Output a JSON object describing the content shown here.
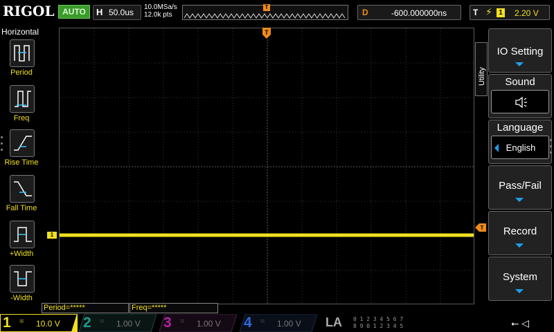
{
  "topbar": {
    "brand": "RIGOL",
    "run_state": "AUTO",
    "timebase_key": "H",
    "timebase_value": "50.0us",
    "sample_rate": "10.0MSa/s",
    "memory_depth": "12.0k pts",
    "trigger_marker": "T",
    "delay_key": "D",
    "delay_value": "-600.000000ns",
    "trigger_key": "T",
    "trigger_source": "1",
    "trigger_level": "2.20 V"
  },
  "left_panel": {
    "title": "Horizontal",
    "items": [
      {
        "label": "Period",
        "icon": "period-icon"
      },
      {
        "label": "Freq",
        "icon": "freq-icon"
      },
      {
        "label": "Rise Time",
        "icon": "rise-time-icon"
      },
      {
        "label": "Fall Time",
        "icon": "fall-time-icon"
      },
      {
        "label": "+Width",
        "icon": "positive-width-icon"
      },
      {
        "label": "-Width",
        "icon": "negative-width-icon"
      }
    ]
  },
  "measurements": {
    "period": "Period=*****",
    "freq": "Freq=*****"
  },
  "waveform": {
    "ch1_marker": "1",
    "trigger_level_marker": "T"
  },
  "right_menu": {
    "tab": "Utility",
    "items": [
      {
        "title": "IO Setting"
      },
      {
        "title": "Sound",
        "icon": "speaker-icon"
      },
      {
        "title": "Language",
        "value": "English"
      },
      {
        "title": "Pass/Fail"
      },
      {
        "title": "Record"
      },
      {
        "title": "System"
      }
    ]
  },
  "channels": [
    {
      "num": "1",
      "coupling": "=",
      "scale": "10.0 V",
      "color": "#f0e020"
    },
    {
      "num": "2",
      "coupling": "=",
      "scale": "1.00 V",
      "color": "#1e9a8a"
    },
    {
      "num": "3",
      "coupling": "=",
      "scale": "1.00 V",
      "color": "#b0239c"
    },
    {
      "num": "4",
      "coupling": "=",
      "scale": "1.00 V",
      "color": "#2a6ae0"
    }
  ],
  "logic": {
    "label": "LA",
    "row1": "0 1 2 3  4 5 6 7",
    "row2": "8 9 0 1  2 3 4 5"
  },
  "colors": {
    "ch1": "#f0e020",
    "accent_orange": "#f08a1a",
    "menu_arrow": "#1e9fe8"
  }
}
